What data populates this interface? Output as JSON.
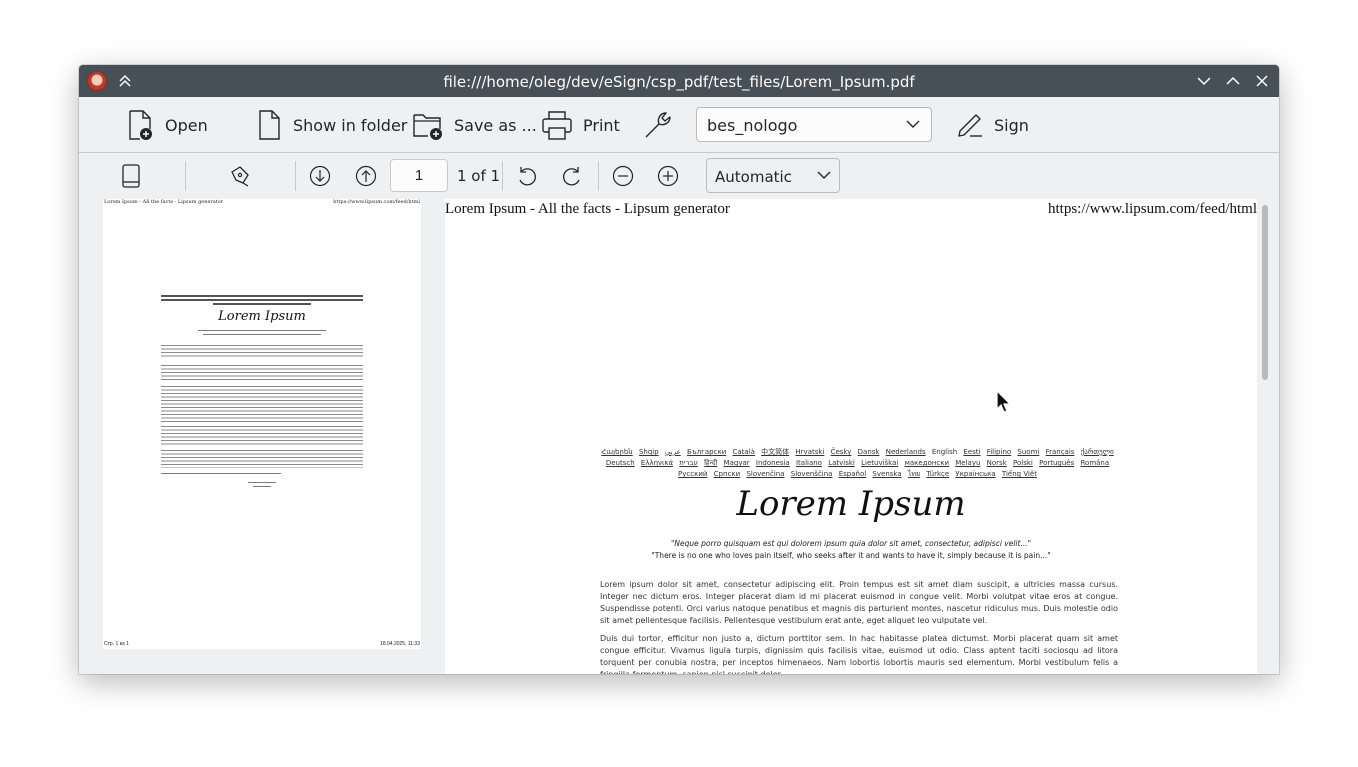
{
  "window": {
    "title": "file:///home/oleg/dev/eSign/csp_pdf/test_files/Lorem_Ipsum.pdf"
  },
  "toolbar": {
    "open_label": "Open",
    "show_in_folder_label": "Show in folder",
    "save_as_label": "Save as ...",
    "print_label": "Print",
    "certificate_selected": "bes_nologo",
    "sign_label": "Sign"
  },
  "nav": {
    "page_number": "1",
    "page_count": "1 of 1",
    "zoom": "Automatic"
  },
  "thumbnail": {
    "header_left": "Lorem Ipsum - All the facts - Lipsum generator",
    "header_right": "https://www.lipsum.com/feed/html",
    "title": "Lorem Ipsum",
    "footer_left": "Стр. 1 из 1",
    "footer_right": "18.04.2025, 11:33"
  },
  "document": {
    "header_left": "Lorem Ipsum - All the facts - Lipsum generator",
    "header_right": "https://www.lipsum.com/feed/html",
    "languages": [
      "Հայերեն",
      "Shqip",
      "عربي",
      "Български",
      "Català",
      "中文简体",
      "Hrvatski",
      "Česky",
      "Dansk",
      "Nederlands",
      "English",
      "Eesti",
      "Filipino",
      "Suomi",
      "Français",
      "ქართული",
      "Deutsch",
      "Ελληνικά",
      "עברית",
      "हिन्दी",
      "Magyar",
      "Indonesia",
      "Italiano",
      "Latviski",
      "Lietuviškai",
      "македонски",
      "Melayu",
      "Norsk",
      "Polski",
      "Português",
      "Româna",
      "Pyccкий",
      "Српски",
      "Slovenčina",
      "Slovenščina",
      "Español",
      "Svenska",
      "ไทย",
      "Türkçe",
      "Українська",
      "Tiếng Việt"
    ],
    "current_language": "English",
    "title": "Lorem Ipsum",
    "quote_latin": "\"Neque porro quisquam est qui dolorem ipsum quia dolor sit amet, consectetur, adipisci velit...\"",
    "quote_english": "\"There is no one who loves pain itself, who seeks after it and wants to have it, simply because it is pain...\"",
    "paragraph1": "Lorem ipsum dolor sit amet, consectetur adipiscing elit. Proin tempus est sit amet diam suscipit, a ultricies massa cursus. Integer nec dictum eros. Integer placerat diam id mi placerat euismod in congue velit. Morbi volutpat vitae eros at congue. Suspendisse potenti. Orci varius natoque penatibus et magnis dis parturient montes, nascetur ridiculus mus. Duis molestie odio sit amet pellentesque facilisis. Pellentesque vestibulum erat ante, eget aliquet leo vulputate vel.",
    "paragraph2": "Duis dui tortor, efficitur non justo a, dictum porttitor sem. In hac habitasse platea dictumst. Morbi placerat quam sit amet congue efficitur. Vivamus ligula turpis, dignissim quis facilisis vitae, euismod ut odio. Class aptent taciti sociosqu ad litora torquent per conubia nostra, per inceptos himenaeos. Nam lobortis lobortis mauris sed elementum. Morbi vestibulum felis a fringilla fermentum, sapien nisl suscipit dolor"
  }
}
